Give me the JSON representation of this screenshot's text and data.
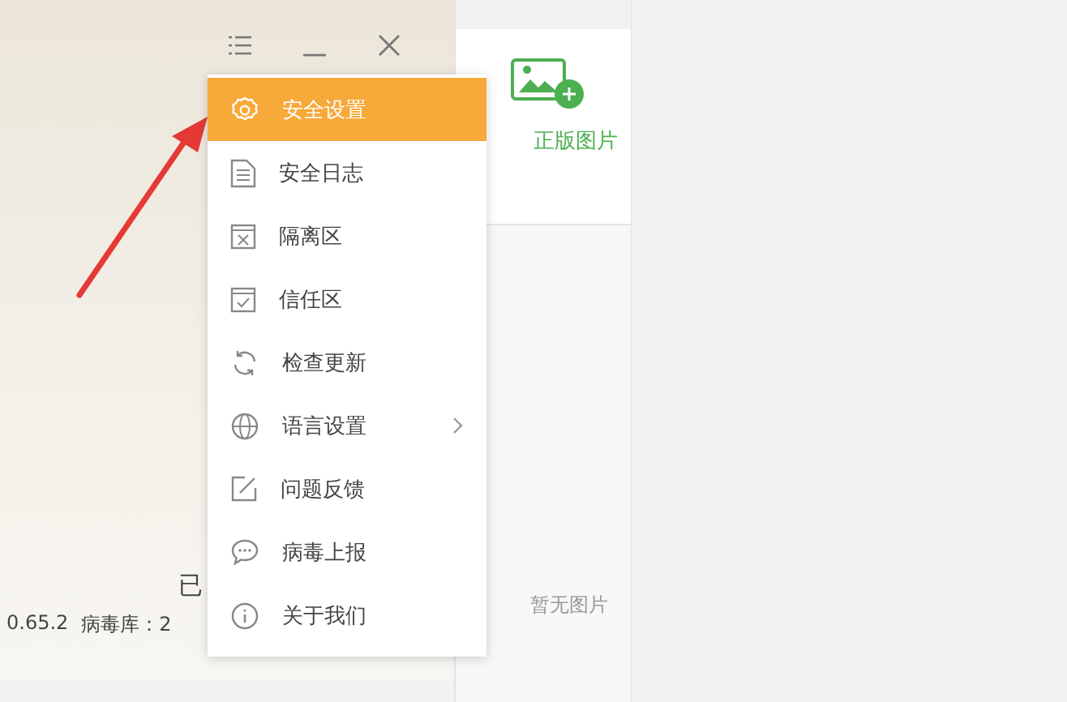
{
  "titlebar": {
    "buttons": [
      {
        "kind": "menu"
      },
      {
        "kind": "minimize"
      },
      {
        "kind": "close"
      }
    ]
  },
  "status": {
    "partial": "已",
    "version": "0.65.2",
    "virus_db": "病毒库：2"
  },
  "side_panel": {
    "card_label": "正版图片",
    "empty_text": "暂无图片"
  },
  "menu": {
    "items": [
      {
        "label": "安全设置",
        "selected": true,
        "submenu": false
      },
      {
        "label": "安全日志",
        "selected": false,
        "submenu": false
      },
      {
        "label": "隔离区",
        "selected": false,
        "submenu": false
      },
      {
        "label": "信任区",
        "selected": false,
        "submenu": false
      },
      {
        "label": "检查更新",
        "selected": false,
        "submenu": false
      },
      {
        "label": "语言设置",
        "selected": false,
        "submenu": true
      },
      {
        "label": "问题反馈",
        "selected": false,
        "submenu": false
      },
      {
        "label": "病毒上报",
        "selected": false,
        "submenu": false
      },
      {
        "label": "关于我们",
        "selected": false,
        "submenu": false
      }
    ]
  }
}
